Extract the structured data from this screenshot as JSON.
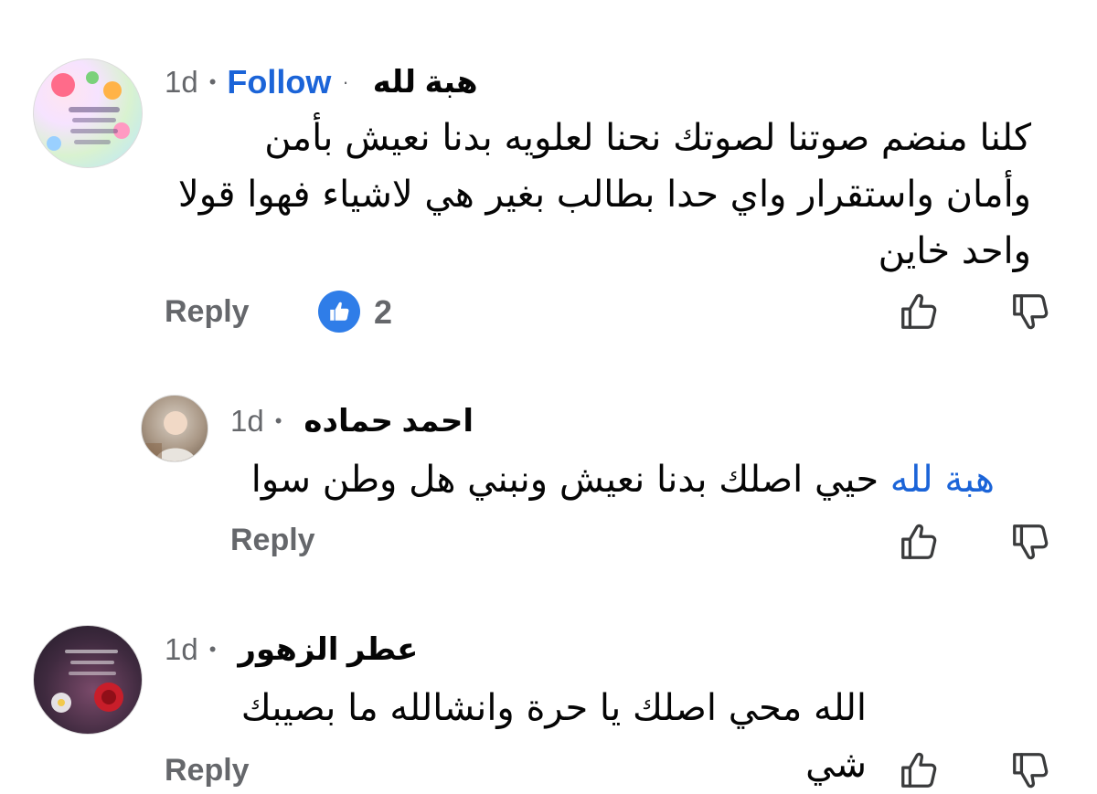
{
  "comments": [
    {
      "author": "هبة  لله",
      "time": "1d",
      "follow": "Follow",
      "lines": [
        "كلنا منضم صوتنا لصوتك نحنا لعلويه بدنا نعيش بأمن",
        "وأمان واستقرار واي حدا بطالب بغير هي لاشياء فهوا قولا",
        "واحد خاين"
      ],
      "reply": "Reply",
      "reaction_count": "2",
      "reaction_icon": "like-badge-icon"
    },
    {
      "author": "احمد حماده",
      "time": "1d",
      "mention": "هبة لله",
      "text": "حيي اصلك بدنا نعيش ونبني هل وطن سوا",
      "reply": "Reply"
    },
    {
      "author": "عطر الزهور",
      "time": "1d",
      "text": "الله محي اصلك يا حرة وانشالله ما بصيبك شي",
      "reply": "Reply"
    }
  ],
  "colors": {
    "link": "#1b64d8",
    "meta": "#65676b",
    "like_badge": "#2f7de8"
  },
  "icons": [
    "thumbs-up-outline-icon",
    "thumbs-down-outline-icon"
  ]
}
